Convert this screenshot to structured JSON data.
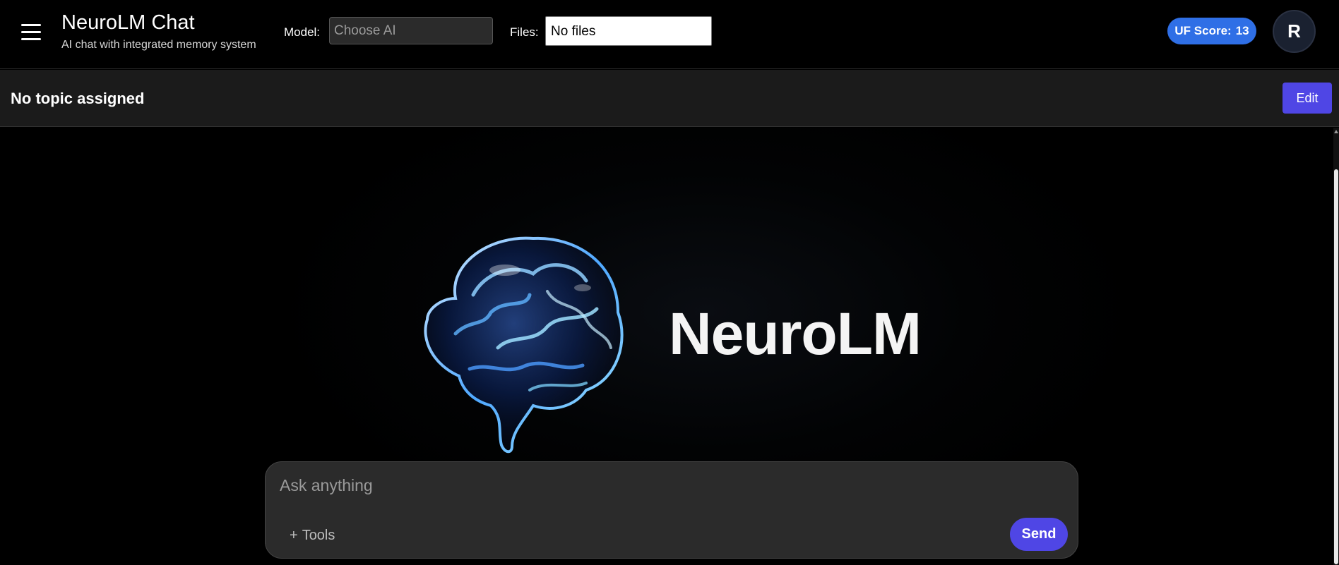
{
  "header": {
    "app_title": "NeuroLM Chat",
    "subtitle": "AI chat with integrated memory system",
    "model_label": "Model:",
    "model_placeholder": "Choose AI",
    "files_label": "Files:",
    "files_value": "No files",
    "score_label": "UF Score:",
    "score_value": "13",
    "avatar_initial": "R"
  },
  "topic": {
    "title": "No topic assigned",
    "edit_label": "Edit"
  },
  "hero": {
    "logo_text": "NeuroLM"
  },
  "composer": {
    "placeholder": "Ask anything",
    "tools_icon": "+",
    "tools_label": "Tools",
    "send_label": "Send"
  },
  "icons": {
    "menu": "hamburger-icon",
    "brain": "brain-icon"
  },
  "colors": {
    "accent": "#4f46e5",
    "badge": "#2f6fe6"
  }
}
